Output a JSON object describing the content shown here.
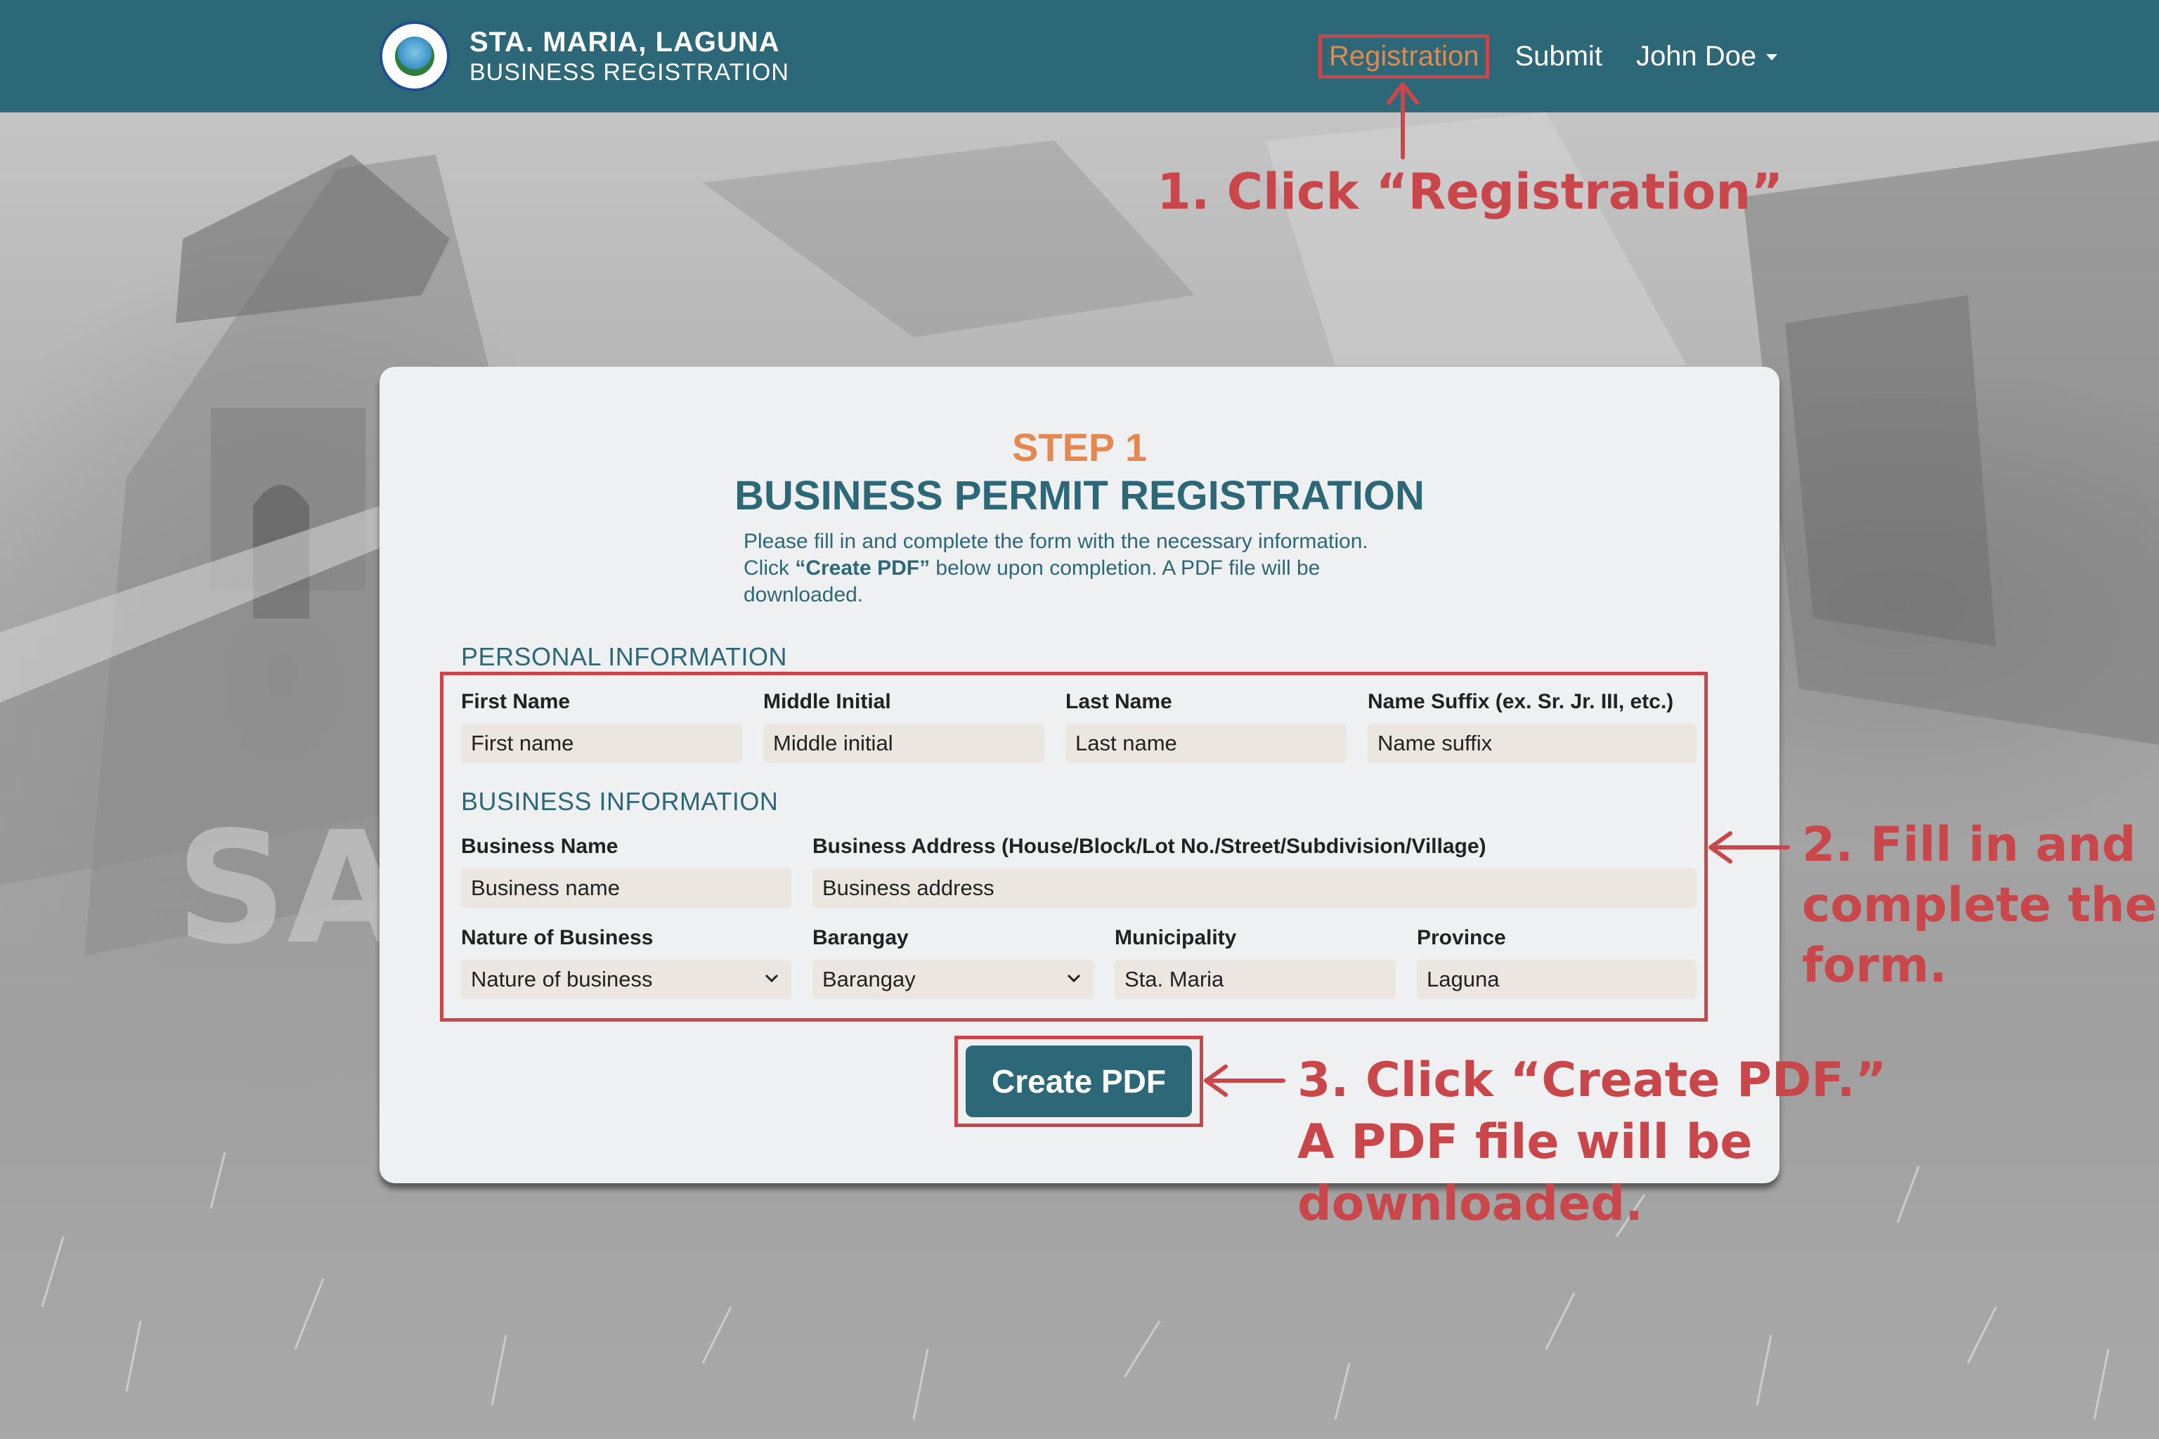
{
  "header": {
    "title": "STA. MARIA, LAGUNA",
    "subtitle": "BUSINESS REGISTRATION",
    "nav": {
      "registration": "Registration",
      "submit": "Submit",
      "user": "John Doe"
    }
  },
  "form": {
    "step": "STEP 1",
    "title": "BUSINESS PERMIT REGISTRATION",
    "desc_line1": "Please fill in and complete the form with the necessary information.",
    "desc_pre": "Click ",
    "desc_bold": "“Create PDF”",
    "desc_post": " below upon completion. A PDF file will be downloaded.",
    "personal_heading": "PERSONAL INFORMATION",
    "business_heading": "BUSINESS INFORMATION",
    "fields": {
      "first_name": {
        "label": "First Name",
        "placeholder": "First name"
      },
      "middle_initial": {
        "label": "Middle Initial",
        "placeholder": "Middle initial"
      },
      "last_name": {
        "label": "Last Name",
        "placeholder": "Last name"
      },
      "name_suffix": {
        "label": "Name Suffix (ex. Sr. Jr. III, etc.)",
        "placeholder": "Name suffix"
      },
      "business_name": {
        "label": "Business Name",
        "placeholder": "Business name"
      },
      "business_address": {
        "label": "Business Address (House/Block/Lot No./Street/Subdivision/Village)",
        "placeholder": "Business address"
      },
      "nature": {
        "label": "Nature of Business",
        "value": "Nature of business"
      },
      "barangay": {
        "label": "Barangay",
        "value": "Barangay"
      },
      "municipality": {
        "label": "Municipality",
        "value": "Sta. Maria"
      },
      "province": {
        "label": "Province",
        "value": "Laguna"
      }
    },
    "create_pdf": "Create PDF"
  },
  "annotations": {
    "step1": "1. Click “Registration”",
    "step2_l1": "2. Fill in and",
    "step2_l2": "complete the",
    "step2_l3": "form.",
    "step3_l1": "3. Click “Create PDF.”",
    "step3_l2": "A PDF file will be",
    "step3_l3": "downloaded."
  },
  "colors": {
    "nav": "#2c6878",
    "accent_orange": "#e5884f",
    "annotation_red": "#c9474b",
    "field_bg": "#ebe7e0"
  }
}
